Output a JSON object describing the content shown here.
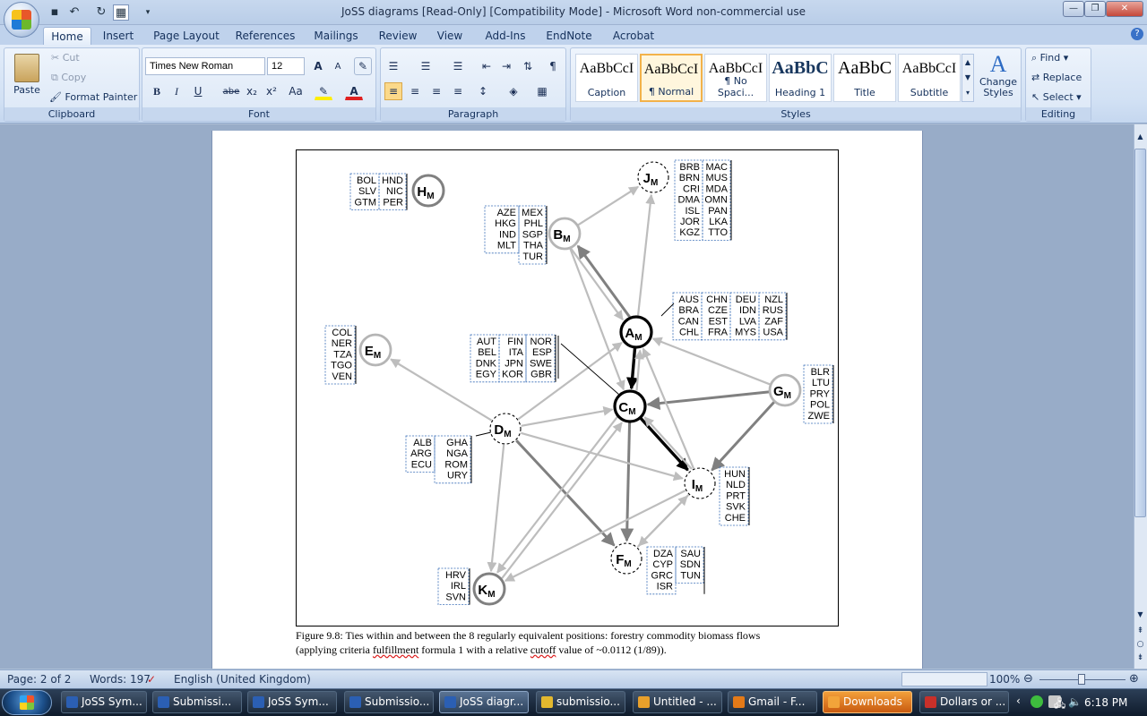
{
  "window": {
    "title": "JoSS diagrams [Read-Only] [Compatibility Mode] - Microsoft Word non-commercial use"
  },
  "qat": {
    "icons": [
      "save-icon",
      "undo-icon",
      "redo-icon",
      "table-icon",
      "customize-icon"
    ]
  },
  "tabs": [
    "Home",
    "Insert",
    "Page Layout",
    "References",
    "Mailings",
    "Review",
    "View",
    "Add-Ins",
    "EndNote",
    "Acrobat"
  ],
  "clipboard": {
    "paste": "Paste",
    "cut": "Cut",
    "copy": "Copy",
    "format_painter": "Format Painter",
    "label": "Clipboard"
  },
  "font": {
    "name": "Times New Roman",
    "size": "12",
    "label": "Font",
    "bold": "B",
    "italic": "I",
    "underline": "U",
    "strike": "abe",
    "sub": "x₂",
    "sup": "x²",
    "case": "Aa",
    "grow": "A",
    "shrink": "A"
  },
  "paragraph": {
    "label": "Paragraph"
  },
  "styles": {
    "label": "Styles",
    "items": [
      {
        "sample": "AaBbCcI",
        "name": "Caption"
      },
      {
        "sample": "AaBbCcI",
        "name": "¶ Normal"
      },
      {
        "sample": "AaBbCcI",
        "name": "¶ No Spaci..."
      },
      {
        "sample": "AaBbC",
        "name": "Heading 1"
      },
      {
        "sample": "AaBbC",
        "name": "Title"
      },
      {
        "sample": "AaBbCcI",
        "name": "Subtitle"
      }
    ],
    "change": "Change Styles"
  },
  "editing": {
    "label": "Editing",
    "find": "Find",
    "replace": "Replace",
    "select": "Select"
  },
  "figure": {
    "nodes": {
      "A": "A",
      "B": "B",
      "C": "C",
      "D": "D",
      "E": "E",
      "F": "F",
      "G": "G",
      "H": "H",
      "I": "I",
      "J": "J",
      "K": "K",
      "sub": "M"
    },
    "lists": {
      "H": [
        [
          "BOL",
          "SLV",
          "GTM"
        ],
        [
          "HND",
          "NIC",
          "PER"
        ]
      ],
      "B": [
        [
          "AZE",
          "HKG",
          "IND",
          "MLT"
        ],
        [
          "MEX",
          "PHL",
          "SGP",
          "THA",
          "TUR"
        ]
      ],
      "J": [
        [
          "BRB",
          "BRN",
          "CRI",
          "DMA",
          "ISL",
          "JOR",
          "KGZ"
        ],
        [
          "MAC",
          "MUS",
          "MDA",
          "OMN",
          "PAN",
          "LKA",
          "TTO"
        ]
      ],
      "A": [
        [
          "AUS",
          "BRA",
          "CAN",
          "CHL"
        ],
        [
          "CHN",
          "CZE",
          "EST",
          "FRA"
        ],
        [
          "DEU",
          "IDN",
          "LVA",
          "MYS"
        ],
        [
          "NZL",
          "RUS",
          "ZAF",
          "USA"
        ]
      ],
      "E": [
        [
          "COL",
          "NER",
          "TZA",
          "TGO",
          "VEN"
        ]
      ],
      "C": [
        [
          "AUT",
          "BEL",
          "DNK",
          "EGY"
        ],
        [
          "FIN",
          "ITA",
          "JPN",
          "KOR"
        ],
        [
          "NOR",
          "ESP",
          "SWE",
          "GBR"
        ]
      ],
      "G": [
        [
          "BLR",
          "LTU",
          "PRY",
          "POL",
          "ZWE"
        ]
      ],
      "D": [
        [
          "ALB",
          "ARG",
          "ECU"
        ],
        [
          "GHA",
          "NGA",
          "ROM",
          "URY"
        ]
      ],
      "I": [
        [
          "HUN",
          "NLD",
          "PRT",
          "SVK",
          "CHE"
        ]
      ],
      "F": [
        [
          "DZA",
          "CYP",
          "GRC",
          "ISR"
        ],
        [
          "SAU",
          "SDN",
          "TUN"
        ]
      ],
      "K": [
        [
          "HRV",
          "IRL",
          "SVN"
        ]
      ]
    }
  },
  "caption": {
    "line1": "Figure 9.8: Ties within and between the 8 regularly equivalent positions: forestry commodity biomass flows",
    "line2a": "(applying criteria ",
    "line2b": "fulfillment",
    "line2c": " formula 1 with a relative ",
    "line2d": "cutoff",
    "line2e": " value of ~0.0112 (1/89))."
  },
  "status": {
    "page": "Page: 2 of 2",
    "words": "Words: 197",
    "language": "English (United Kingdom)",
    "zoom": "100%"
  },
  "taskbar": {
    "items": [
      "JoSS Sym...",
      "Submissi...",
      "JoSS Sym...",
      "Submissio...",
      "JoSS diagr...",
      "submissio...",
      "Untitled - ...",
      "Gmail - F...",
      "Downloads",
      "Dollars or ..."
    ],
    "clock": "6:18 PM"
  }
}
